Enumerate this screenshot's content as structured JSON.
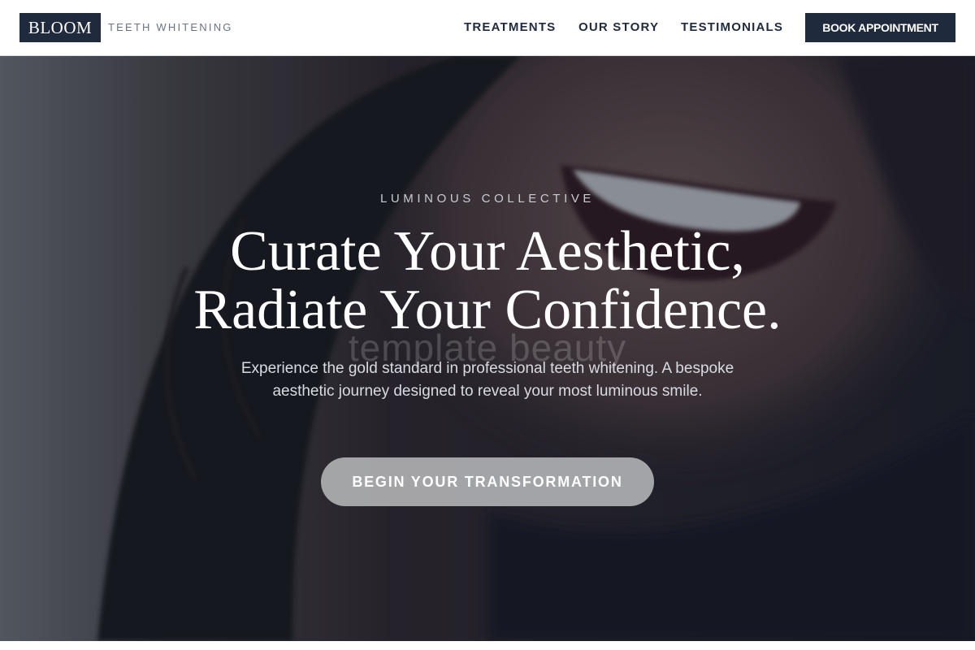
{
  "brand": {
    "logo": "BLOOM",
    "tagline": "TEETH WHITENING"
  },
  "nav": {
    "items": [
      {
        "label": "TREATMENTS"
      },
      {
        "label": "OUR STORY"
      },
      {
        "label": "TESTIMONIALS"
      }
    ],
    "cta_label": "BOOK APPOINTMENT"
  },
  "hero": {
    "eyebrow": "LUMINOUS COLLECTIVE",
    "headline_line1": "Curate Your Aesthetic,",
    "headline_line2": "Radiate Your Confidence.",
    "watermark": "template beauty",
    "description": "Experience the gold standard in professional teeth whitening. A bespoke aesthetic journey designed to reveal your most luminous smile.",
    "cta_label": "BEGIN YOUR TRANSFORMATION"
  },
  "colors": {
    "brand_navy": "#1f2a3c",
    "cta_gray": "#afb0b2",
    "muted_text": "#6b7280"
  }
}
